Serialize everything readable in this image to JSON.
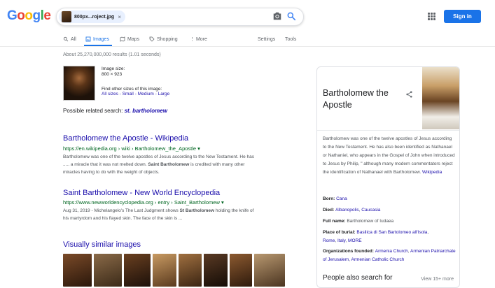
{
  "header": {
    "logo_letters": [
      {
        "ch": "G",
        "color": "#4285f4"
      },
      {
        "ch": "o",
        "color": "#ea4335"
      },
      {
        "ch": "o",
        "color": "#fbbc05"
      },
      {
        "ch": "g",
        "color": "#4285f4"
      },
      {
        "ch": "l",
        "color": "#34a853"
      },
      {
        "ch": "e",
        "color": "#ea4335"
      }
    ],
    "search_chip_label": "800px...roject.jpg",
    "chip_close": "×",
    "sign_in": "Sign in"
  },
  "tabs": {
    "all": "All",
    "images": "Images",
    "maps": "Maps",
    "shopping": "Shopping",
    "more": "⋮ More",
    "settings": "Settings",
    "tools": "Tools"
  },
  "results_count": "About 25,270,000,000 results (1.01 seconds)",
  "image_info": {
    "size_label": "Image size:",
    "size_value": "800 × 923",
    "other_sizes": "Find other sizes of this image:",
    "sizes_all": "All sizes",
    "sizes_small": "Small",
    "sizes_medium": "Medium",
    "sizes_large": "Large",
    "sep": " - "
  },
  "related": {
    "label": "Possible related search: ",
    "term": "st. bartholomew"
  },
  "results": [
    {
      "title": "Bartholomew the Apostle - Wikipedia",
      "url": "https://en.wikipedia.org › wiki › Bartholomew_the_Apostle ▾",
      "snip1": "Bartholomew was one of the twelve apostles of Jesus according to the New Testament. He has",
      "snip2a": "..... a miracle that it was not melted down. ",
      "snip2b": "Saint Bartholomew",
      "snip2c": " is credited with many other",
      "snip3": "miracles having to do with the weight of objects."
    },
    {
      "title": "Saint Bartholomew - New World Encyclopedia",
      "url": "https://www.newworldencyclopedia.org › entry › Saint_Bartholomew ▾",
      "snip1a": "Aug 31, 2019 - Michelangelo's The Last Judgment shows ",
      "snip1b": "St Bartholomew",
      "snip1c": " holding the knife of",
      "snip2": "his martyrdom and his flayed skin. The face of the skin is ..."
    }
  ],
  "visually_similar": "Visually similar images",
  "knowledge_panel": {
    "title": "Bartholomew the Apostle",
    "description": "Bartholomew was one of the twelve apostles of Jesus according to the New Testament. He has also been identified as Nathanael or Nathaniel, who appears in the Gospel of John when introduced to Jesus by Philip, \" although many modern commentators reject the identification of Nathanael with Bartholomew.",
    "desc_link": "Wikipedia",
    "born_label": "Born: ",
    "born_value": "Cana",
    "died_label": "Died: ",
    "died_value1": "Albanopolis",
    "died_sep": ", ",
    "died_value2": "Caucasia",
    "fullname_label": "Full name: ",
    "fullname_value": "Bartholomew of Iudaea",
    "burial_label": "Place of burial: ",
    "burial_value1": "Basilica di San Bartolomeo all'Isola",
    "burial_value2": "Rome",
    "burial_value3": "Italy",
    "burial_value4": "MORE",
    "orgs_label": "Organizations founded: ",
    "orgs_value1": "Armenia Church",
    "orgs_value2": "Armenian Patriarchate of Jerusalem",
    "orgs_value3": "Armenian Catholic Church",
    "people_also": "People also search for",
    "view_more": "View 15+ more"
  }
}
